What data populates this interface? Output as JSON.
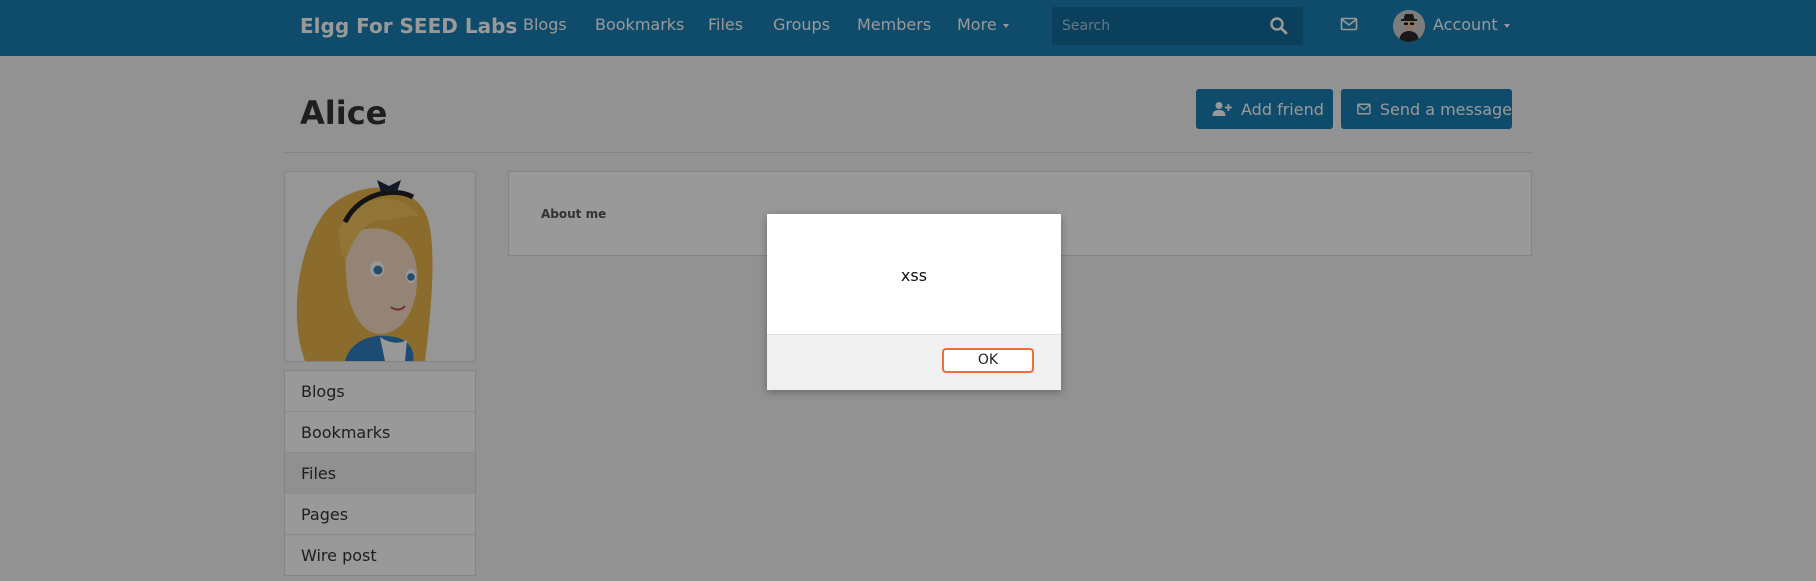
{
  "topbar": {
    "brand": "Elgg For SEED Labs",
    "nav": [
      "Blogs",
      "Bookmarks",
      "Files",
      "Groups",
      "Members"
    ],
    "more_label": "More",
    "search_placeholder": "Search",
    "account_label": "Account",
    "icons": {
      "search": "search-icon",
      "mail": "envelope-icon",
      "avatar": "spy-avatar"
    }
  },
  "profile": {
    "name": "Alice",
    "add_friend_label": "Add friend",
    "send_message_label": "Send a message",
    "about_label": "About me"
  },
  "sidebar": {
    "items": [
      "Blogs",
      "Bookmarks",
      "Files",
      "Pages",
      "Wire post"
    ]
  },
  "dialog": {
    "message": "xss",
    "ok_label": "OK"
  },
  "colors": {
    "brand": "#1a7db1",
    "overlay": "rgba(0,0,0,0.4)",
    "focus": "#f06b3b"
  }
}
